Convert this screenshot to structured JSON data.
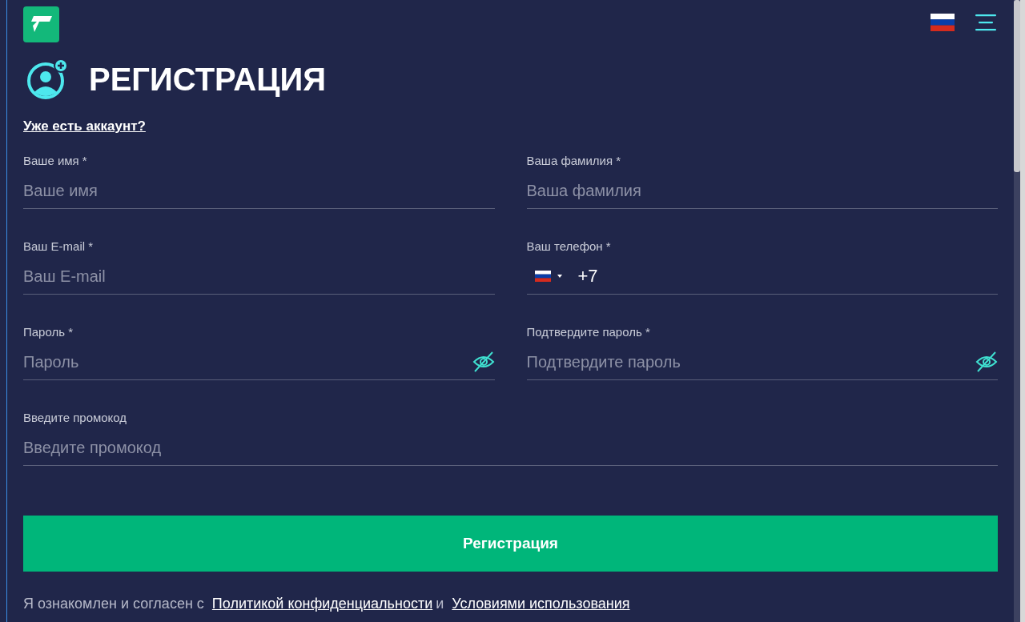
{
  "header": {
    "title": "РЕГИСТРАЦИЯ",
    "login_link": "Уже есть аккаунт?"
  },
  "fields": [
    {
      "kind": "text",
      "label": "Ваше имя *",
      "placeholder": "Ваше имя"
    },
    {
      "kind": "text",
      "label": "Ваша фамилия *",
      "placeholder": "Ваша фамилия"
    },
    {
      "kind": "text",
      "label": "Ваш E-mail *",
      "placeholder": "Ваш E-mail"
    },
    {
      "kind": "phone",
      "label": "Ваш телефон *",
      "value": "+7"
    },
    {
      "kind": "password",
      "label": "Пароль *",
      "placeholder": "Пароль"
    },
    {
      "kind": "password",
      "label": "Подтвердите пароль *",
      "placeholder": "Подтвердите пароль"
    },
    {
      "kind": "wide",
      "label": "Введите промокод",
      "placeholder": "Введите промокод"
    }
  ],
  "submit": "Регистрация",
  "terms": {
    "text": "Я ознакомлен и согласен с",
    "privacy_link": "Политикой конфиденциальности",
    "joiner": "и",
    "terms_link": "Условиями использования"
  }
}
